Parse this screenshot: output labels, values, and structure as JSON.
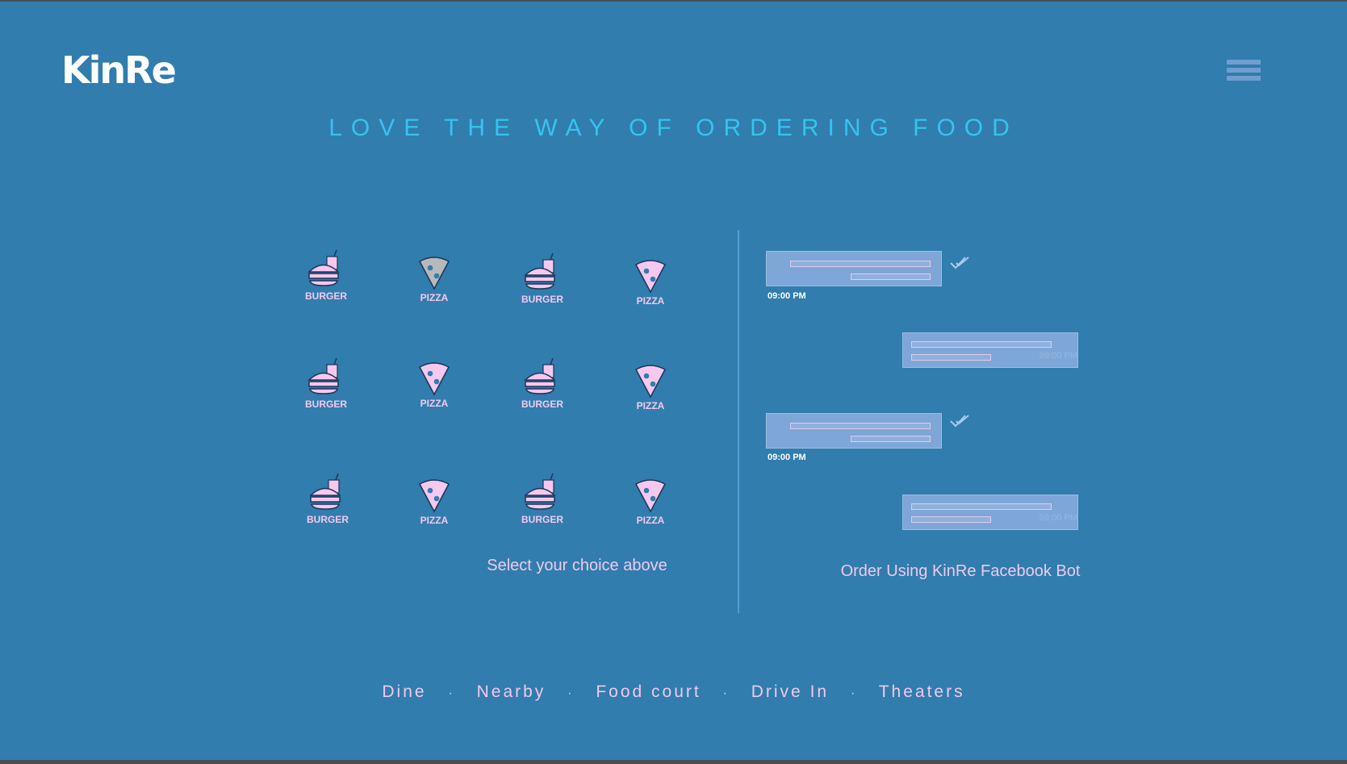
{
  "brand": {
    "logo_text": "KinRe"
  },
  "header": {
    "menu_icon": "hamburger-menu-icon"
  },
  "hero": {
    "title": "LOVE THE WAY OF ORDERING FOOD"
  },
  "food_grid": {
    "items": [
      {
        "label": "BURGER",
        "icon": "burger-drink-icon"
      },
      {
        "label": "PIZZA",
        "icon": "pizza-slice-icon",
        "selected": true
      },
      {
        "label": "BURGER",
        "icon": "burger-drink-icon"
      },
      {
        "label": "PIZZA",
        "icon": "pizza-slice-icon"
      },
      {
        "label": "BURGER",
        "icon": "burger-drink-icon"
      },
      {
        "label": "PIZZA",
        "icon": "pizza-slice-icon"
      },
      {
        "label": "BURGER",
        "icon": "burger-drink-icon"
      },
      {
        "label": "PIZZA",
        "icon": "pizza-slice-icon"
      },
      {
        "label": "BURGER",
        "icon": "burger-drink-icon"
      },
      {
        "label": "PIZZA",
        "icon": "pizza-slice-icon"
      },
      {
        "label": "BURGER",
        "icon": "burger-drink-icon"
      },
      {
        "label": "PIZZA",
        "icon": "pizza-slice-icon"
      }
    ],
    "caption": "Select your choice above"
  },
  "chat": {
    "messages": [
      {
        "direction": "outgoing",
        "time": "09:00 PM",
        "status_icon": "double-check-icon"
      },
      {
        "direction": "incoming",
        "time": "09:00 PM"
      },
      {
        "direction": "outgoing",
        "time": "09:00 PM",
        "status_icon": "double-check-icon"
      },
      {
        "direction": "incoming",
        "time": "09:00 PM"
      }
    ],
    "caption": "Order Using KinRe Facebook Bot"
  },
  "footer": {
    "links": [
      "Dine",
      "Nearby",
      "Food court",
      "Drive In",
      "Theaters"
    ],
    "separator": "·"
  },
  "colors": {
    "background": "#307dae",
    "title": "#35c4ee",
    "pink": "#f6c8ee",
    "pizza_selected": "#b9b9bb",
    "bubble": "#7ea6d7"
  }
}
